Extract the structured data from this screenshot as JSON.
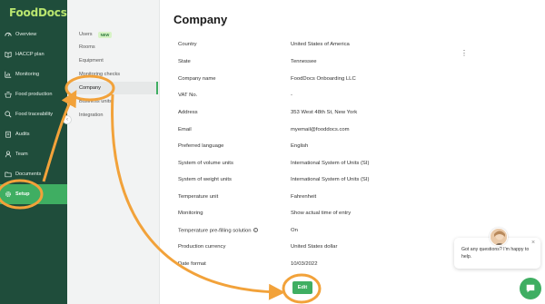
{
  "app": {
    "logo_text": "FoodDocs",
    "brand_color": "#b9e66f",
    "accent_color": "#3fae62",
    "sidebar_color": "#1f4d3b"
  },
  "sidebar": {
    "items": [
      {
        "label": "Overview",
        "icon": "speedometer-icon",
        "active": false
      },
      {
        "label": "HACCP plan",
        "icon": "book-icon",
        "active": false
      },
      {
        "label": "Monitoring",
        "icon": "chart-icon",
        "active": false
      },
      {
        "label": "Food production",
        "icon": "cooking-pot-icon",
        "active": false
      },
      {
        "label": "Food traceability",
        "icon": "search-icon",
        "active": false
      },
      {
        "label": "Audits",
        "icon": "clipboard-icon",
        "active": false
      },
      {
        "label": "Team",
        "icon": "person-icon",
        "active": false
      },
      {
        "label": "Documents",
        "icon": "folder-icon",
        "active": false
      },
      {
        "label": "Setup",
        "icon": "gear-icon",
        "active": true
      }
    ]
  },
  "submenu": {
    "items": [
      {
        "label": "Users",
        "badge": "NEW",
        "active": false
      },
      {
        "label": "Rooms",
        "active": false
      },
      {
        "label": "Equipment",
        "active": false
      },
      {
        "label": "Monitoring checks",
        "active": false
      },
      {
        "label": "Company",
        "active": true
      },
      {
        "label": "Business units",
        "active": false
      },
      {
        "label": "Integration",
        "active": false
      }
    ],
    "collapse_glyph": "‹"
  },
  "main": {
    "title": "Company",
    "fields": [
      {
        "label": "Country",
        "value": "United States of America"
      },
      {
        "label": "State",
        "value": "Tennessee"
      },
      {
        "label": "Company name",
        "value": "FoodDocs Onboarding LLC"
      },
      {
        "label": "VAT No.",
        "value": "-"
      },
      {
        "label": "Address",
        "value": "353 West 48th St, New York"
      },
      {
        "label": "Email",
        "value": "myemail@fooddocs.com"
      },
      {
        "label": "Preferred language",
        "value": "English"
      },
      {
        "label": "System of volume units",
        "value": "International System of Units (SI)"
      },
      {
        "label": "System of weight units",
        "value": "International System of Units (SI)"
      },
      {
        "label": "Temperature unit",
        "value": "Fahrenheit"
      },
      {
        "label": "Monitoring",
        "value": "Show actual time of entry"
      },
      {
        "label": "Temperature pre-filling solution",
        "value": "On",
        "info": "i"
      },
      {
        "label": "Production currency",
        "value": "United States dollar"
      },
      {
        "label": "Date format",
        "value": "10/03/2022"
      }
    ],
    "edit_label": "Edit",
    "more_glyph": "⋮"
  },
  "chat": {
    "message": "Got any questions? I'm happy to help.",
    "close_glyph": "×"
  },
  "annotation": {
    "color": "#f2a23a"
  }
}
